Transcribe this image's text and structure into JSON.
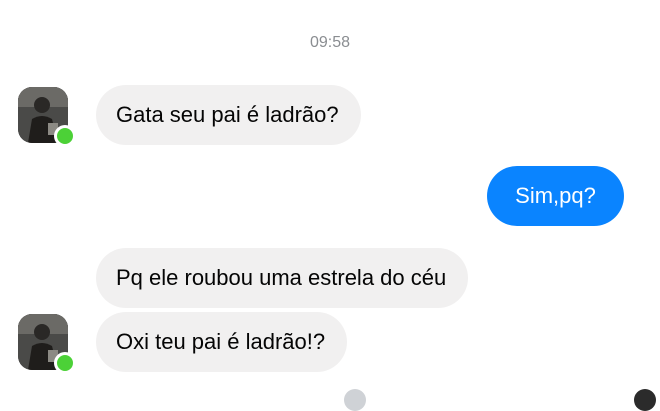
{
  "conversation": {
    "timestamp": "09:58",
    "messages": [
      {
        "sender": "contact",
        "text": "Gata seu pai é ladrão?"
      },
      {
        "sender": "me",
        "text": "Sim,pq?"
      },
      {
        "sender": "contact",
        "text": "Pq ele roubou uma estrela do céu"
      },
      {
        "sender": "contact",
        "text": "Oxi teu pai é ladrão!?"
      }
    ]
  },
  "colors": {
    "incoming_bubble": "#f1f0f0",
    "outgoing_bubble": "#0a84ff",
    "online_status": "#4cd137",
    "timestamp_text": "#8a8d91"
  }
}
